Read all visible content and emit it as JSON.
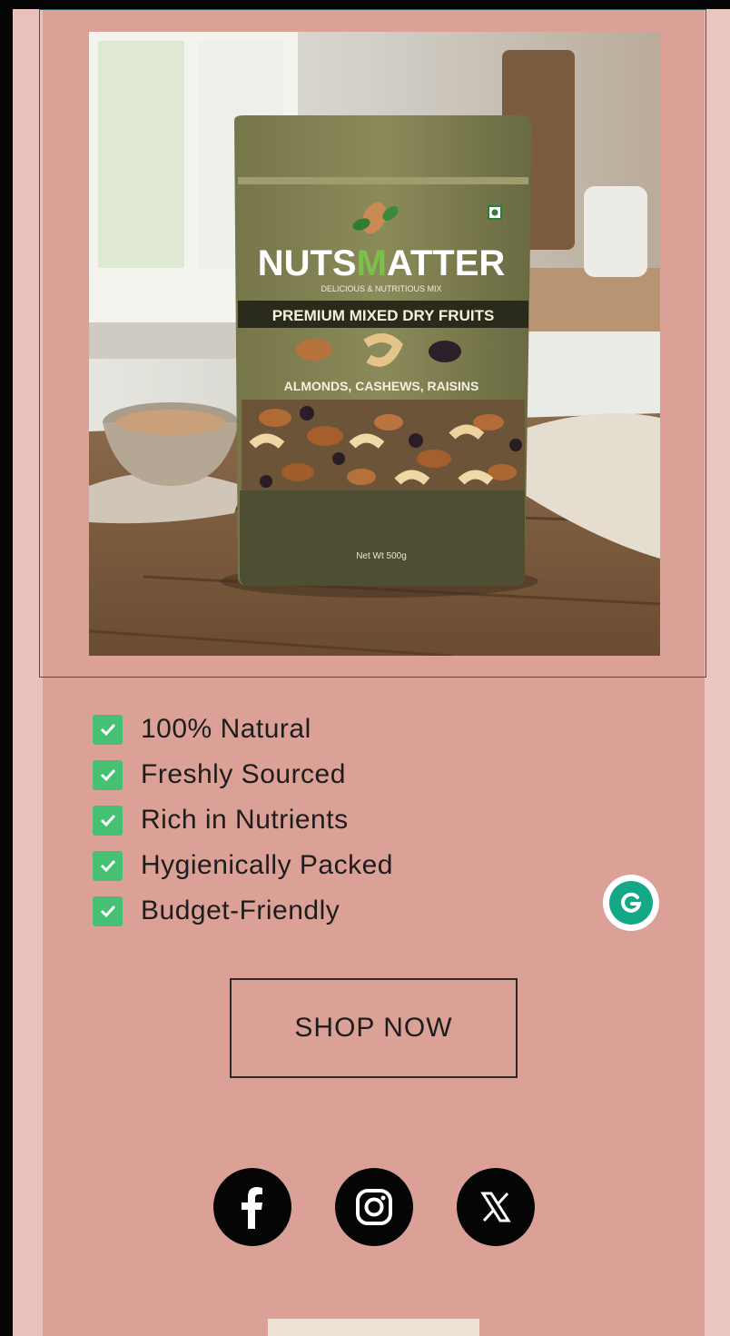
{
  "product": {
    "brand_left": "NUTS",
    "brand_mid": "M",
    "brand_right": "ATTER",
    "tagline": "DELICIOUS & NUTRITIOUS MIX",
    "banner": "PREMIUM MIXED DRY FRUITS",
    "contents": "ALMONDS, CASHEWS, RAISINS",
    "net_weight": "Net Wt 500g"
  },
  "features": [
    {
      "label": "100% Natural"
    },
    {
      "label": "Freshly Sourced"
    },
    {
      "label": "Rich in Nutrients"
    },
    {
      "label": "Hygienically Packed"
    },
    {
      "label": "Budget-Friendly"
    }
  ],
  "cta": {
    "label": "SHOP NOW"
  },
  "social": [
    {
      "icon": "facebook-icon"
    },
    {
      "icon": "instagram-icon"
    },
    {
      "icon": "x-icon"
    }
  ],
  "colors": {
    "card_bg": "#dba196",
    "check_green": "#46c173",
    "pouch_olive": "#6f6f44",
    "grammarly_green": "#15a886"
  }
}
